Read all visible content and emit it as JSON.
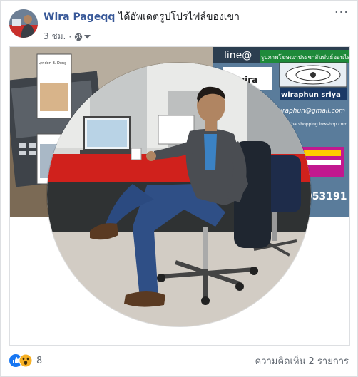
{
  "post": {
    "author": "Wira Pageqq",
    "action": "ได้อัพเดตรูปโปรไฟล์ของเขา",
    "time": "3 ชม.",
    "separator": "·",
    "more": "···"
  },
  "cover_text": {
    "line_at": "line@",
    "banner": "รูปภาพโฆษณาประชาสัมพันธ์ออนไลน์",
    "brand": "@wira",
    "name": "wiraphun sriya",
    "email": "wiraphun@gmail.com",
    "shop": "thatshopping.inwshop.com",
    "phone": "053191",
    "book_title": "Lyndon B. Dong"
  },
  "reactions": {
    "count": "8",
    "comments": "ความคิดเห็น 2 รายการ"
  },
  "colors": {
    "link": "#385898",
    "meta": "#616770",
    "like": "#1877f2",
    "wow": "#f7b125"
  }
}
